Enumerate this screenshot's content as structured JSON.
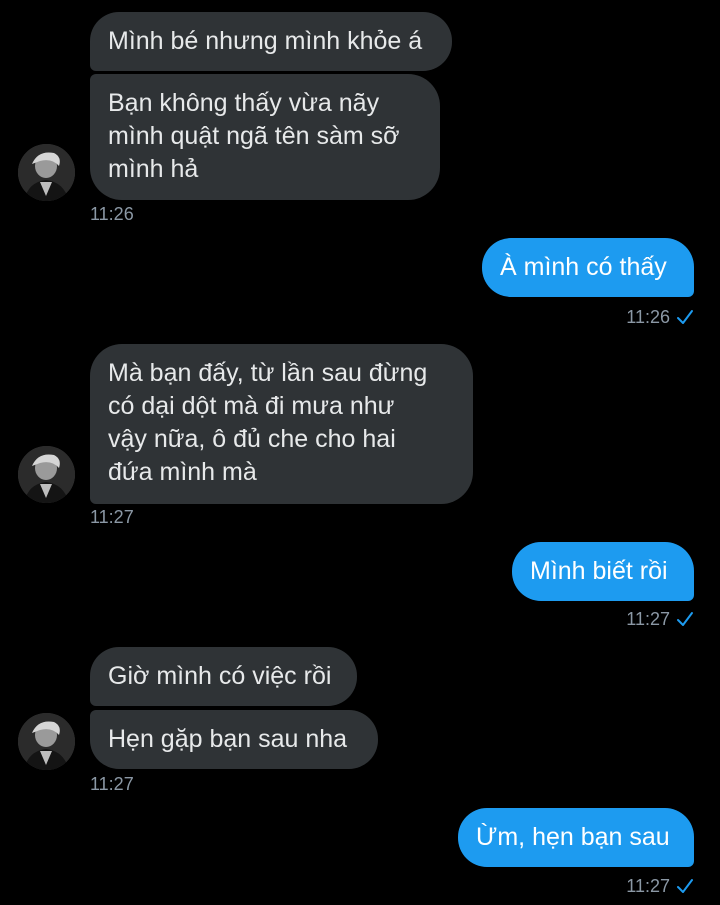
{
  "conversation": {
    "groups": [
      {
        "messages": [
          "Mình bé nhưng mình khỏe á",
          "Bạn không thấy vừa nãy\nmình quật ngã tên sàm sỡ\nmình hả"
        ],
        "time": "11:26"
      },
      {
        "messages": [
          "À mình có thấy"
        ],
        "time": "11:26"
      },
      {
        "messages": [
          "Mà bạn đấy, từ lần sau đừng\ncó dại dột mà đi mưa như\nvậy nữa, ô đủ che cho hai\nđứa mình mà"
        ],
        "time": "11:27"
      },
      {
        "messages": [
          "Mình biết rồi"
        ],
        "time": "11:27"
      },
      {
        "messages": [
          "Giờ mình có việc rồi",
          "Hẹn gặp bạn sau nha"
        ],
        "time": "11:27"
      },
      {
        "messages": [
          "Ừm, hẹn bạn sau"
        ],
        "time": "11:27"
      }
    ]
  },
  "icons": {
    "avatar": "user-avatar",
    "read_receipt": "checkmark-icon"
  },
  "colors": {
    "background": "#000000",
    "incoming_bubble": "#2f3336",
    "outgoing_bubble": "#1d9bf0",
    "timestamp": "#8b98a5",
    "checkmark": "#1d9bf0"
  }
}
